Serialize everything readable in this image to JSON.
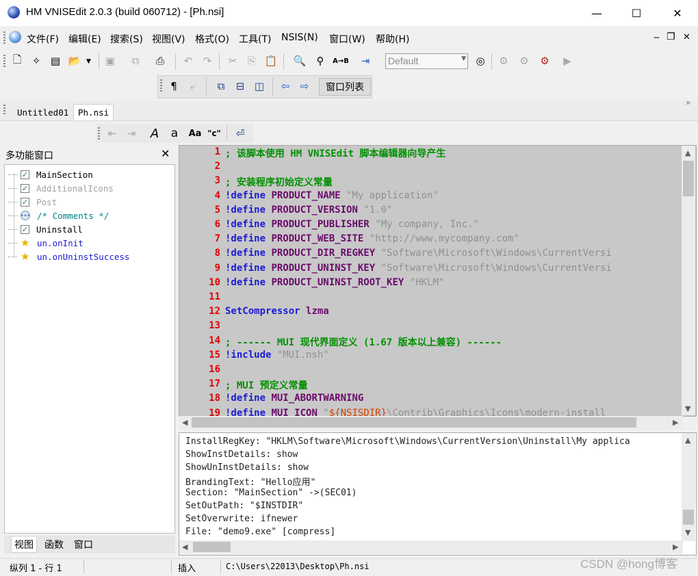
{
  "window": {
    "title": "HM VNISEdit 2.0.3 (build 060712) - [Ph.nsi]",
    "minimize_glyph": "—",
    "maximize_glyph": "☐",
    "close_glyph": "✕"
  },
  "menubar": {
    "items": [
      "文件(F)",
      "编辑(E)",
      "搜索(S)",
      "视图(V)",
      "格式(O)",
      "工具(T)",
      "NSIS(N)",
      "窗口(W)",
      "帮助(H)"
    ],
    "mdi_minimize": "‒",
    "mdi_restore": "❐",
    "mdi_close": "✕"
  },
  "toolbar": {
    "combo_value": "Default",
    "window_list_label": "窗口列表"
  },
  "tabs": [
    "Untitled01",
    "Ph.nsi"
  ],
  "tab_overflow": "»",
  "left_panel": {
    "title": "多功能窗口",
    "close_glyph": "✕",
    "tree": [
      {
        "label": "MainSection",
        "kind": "check",
        "color": "#000000"
      },
      {
        "label": "AdditionalIcons",
        "kind": "check",
        "color": "#a0a0a0"
      },
      {
        "label": "Post",
        "kind": "check",
        "color": "#a0a0a0"
      },
      {
        "label": "/* Comments */",
        "kind": "comment",
        "color": "#008080"
      },
      {
        "label": "Uninstall",
        "kind": "check",
        "color": "#000000"
      },
      {
        "label": "un.onInit",
        "kind": "function",
        "color": "#1b1bd6"
      },
      {
        "label": "un.onUninstSuccess",
        "kind": "function",
        "color": "#1b1bd6"
      }
    ],
    "bottom_tabs": [
      "视图",
      "函数",
      "窗口"
    ]
  },
  "editor": {
    "lines": [
      {
        "n": "1",
        "parts": [
          [
            "cm",
            "; 该脚本使用 HM VNISEdit 脚本编辑器向导产生"
          ]
        ]
      },
      {
        "n": "2",
        "parts": []
      },
      {
        "n": "3",
        "parts": [
          [
            "cm",
            "; 安装程序初始定义常量"
          ]
        ]
      },
      {
        "n": "4",
        "parts": [
          [
            "kw",
            "!define "
          ],
          [
            "cn",
            "PRODUCT_NAME "
          ],
          [
            "st",
            "\"My application\""
          ]
        ]
      },
      {
        "n": "5",
        "parts": [
          [
            "kw",
            "!define "
          ],
          [
            "cn",
            "PRODUCT_VERSION "
          ],
          [
            "st",
            "\"1.0\""
          ]
        ]
      },
      {
        "n": "6",
        "parts": [
          [
            "kw",
            "!define "
          ],
          [
            "cn",
            "PRODUCT_PUBLISHER "
          ],
          [
            "st",
            "\"My company, Inc.\""
          ]
        ]
      },
      {
        "n": "7",
        "parts": [
          [
            "kw",
            "!define "
          ],
          [
            "cn",
            "PRODUCT_WEB_SITE "
          ],
          [
            "st",
            "\"http://www.mycompany.com\""
          ]
        ]
      },
      {
        "n": "8",
        "parts": [
          [
            "kw",
            "!define "
          ],
          [
            "cn",
            "PRODUCT_DIR_REGKEY "
          ],
          [
            "st",
            "\"Software\\Microsoft\\Windows\\CurrentVersi"
          ]
        ]
      },
      {
        "n": "9",
        "parts": [
          [
            "kw",
            "!define "
          ],
          [
            "cn",
            "PRODUCT_UNINST_KEY "
          ],
          [
            "st",
            "\"Software\\Microsoft\\Windows\\CurrentVersi"
          ]
        ]
      },
      {
        "n": "10",
        "parts": [
          [
            "kw",
            "!define "
          ],
          [
            "cn",
            "PRODUCT_UNINST_ROOT_KEY "
          ],
          [
            "st",
            "\"HKLM\""
          ]
        ]
      },
      {
        "n": "11",
        "parts": []
      },
      {
        "n": "12",
        "parts": [
          [
            "kw2",
            "SetCompressor "
          ],
          [
            "nm",
            "lzma"
          ]
        ]
      },
      {
        "n": "13",
        "parts": []
      },
      {
        "n": "14",
        "parts": [
          [
            "cm",
            "; ------ MUI 现代界面定义 (1.67 版本以上兼容) ------"
          ]
        ]
      },
      {
        "n": "15",
        "parts": [
          [
            "kw",
            "!include "
          ],
          [
            "st",
            "\"MUI.nsh\""
          ]
        ]
      },
      {
        "n": "16",
        "parts": []
      },
      {
        "n": "17",
        "parts": [
          [
            "cm",
            "; MUI 预定义常量"
          ]
        ]
      },
      {
        "n": "18",
        "parts": [
          [
            "kw",
            "!define "
          ],
          [
            "cn",
            "MUI_ABORTWARNING"
          ]
        ]
      },
      {
        "n": "19",
        "parts": [
          [
            "kw",
            "!define "
          ],
          [
            "cn",
            "MUI_ICON "
          ],
          [
            "st",
            "\""
          ],
          [
            "vr",
            "${NSISDIR}"
          ],
          [
            "st",
            "\\Contrib\\Graphics\\Icons\\modern-install"
          ]
        ]
      }
    ]
  },
  "output": {
    "lines": [
      "InstallRegKey: \"HKLM\\Software\\Microsoft\\Windows\\CurrentVersion\\Uninstall\\My applica",
      "ShowInstDetails: show",
      "ShowUnInstDetails: show",
      "BrandingText: \"Hello应用\"",
      "Section: \"MainSection\" ->(SEC01)",
      "SetOutPath: \"$INSTDIR\"",
      "SetOverwrite: ifnewer",
      "File: \"demo9.exe\" [compress]"
    ]
  },
  "status": {
    "position": "纵列 1 - 行 1",
    "mode": "插入",
    "path": "C:\\Users\\22013\\Desktop\\Ph.nsi"
  },
  "watermark": "CSDN @hong博客",
  "colors": {
    "line_numbers": "#e00000",
    "comment": "#009000",
    "keyword": "#1b1bd6",
    "constant": "#6a0a6a",
    "string": "#909090",
    "editor_bg": "#c8c8c8"
  }
}
